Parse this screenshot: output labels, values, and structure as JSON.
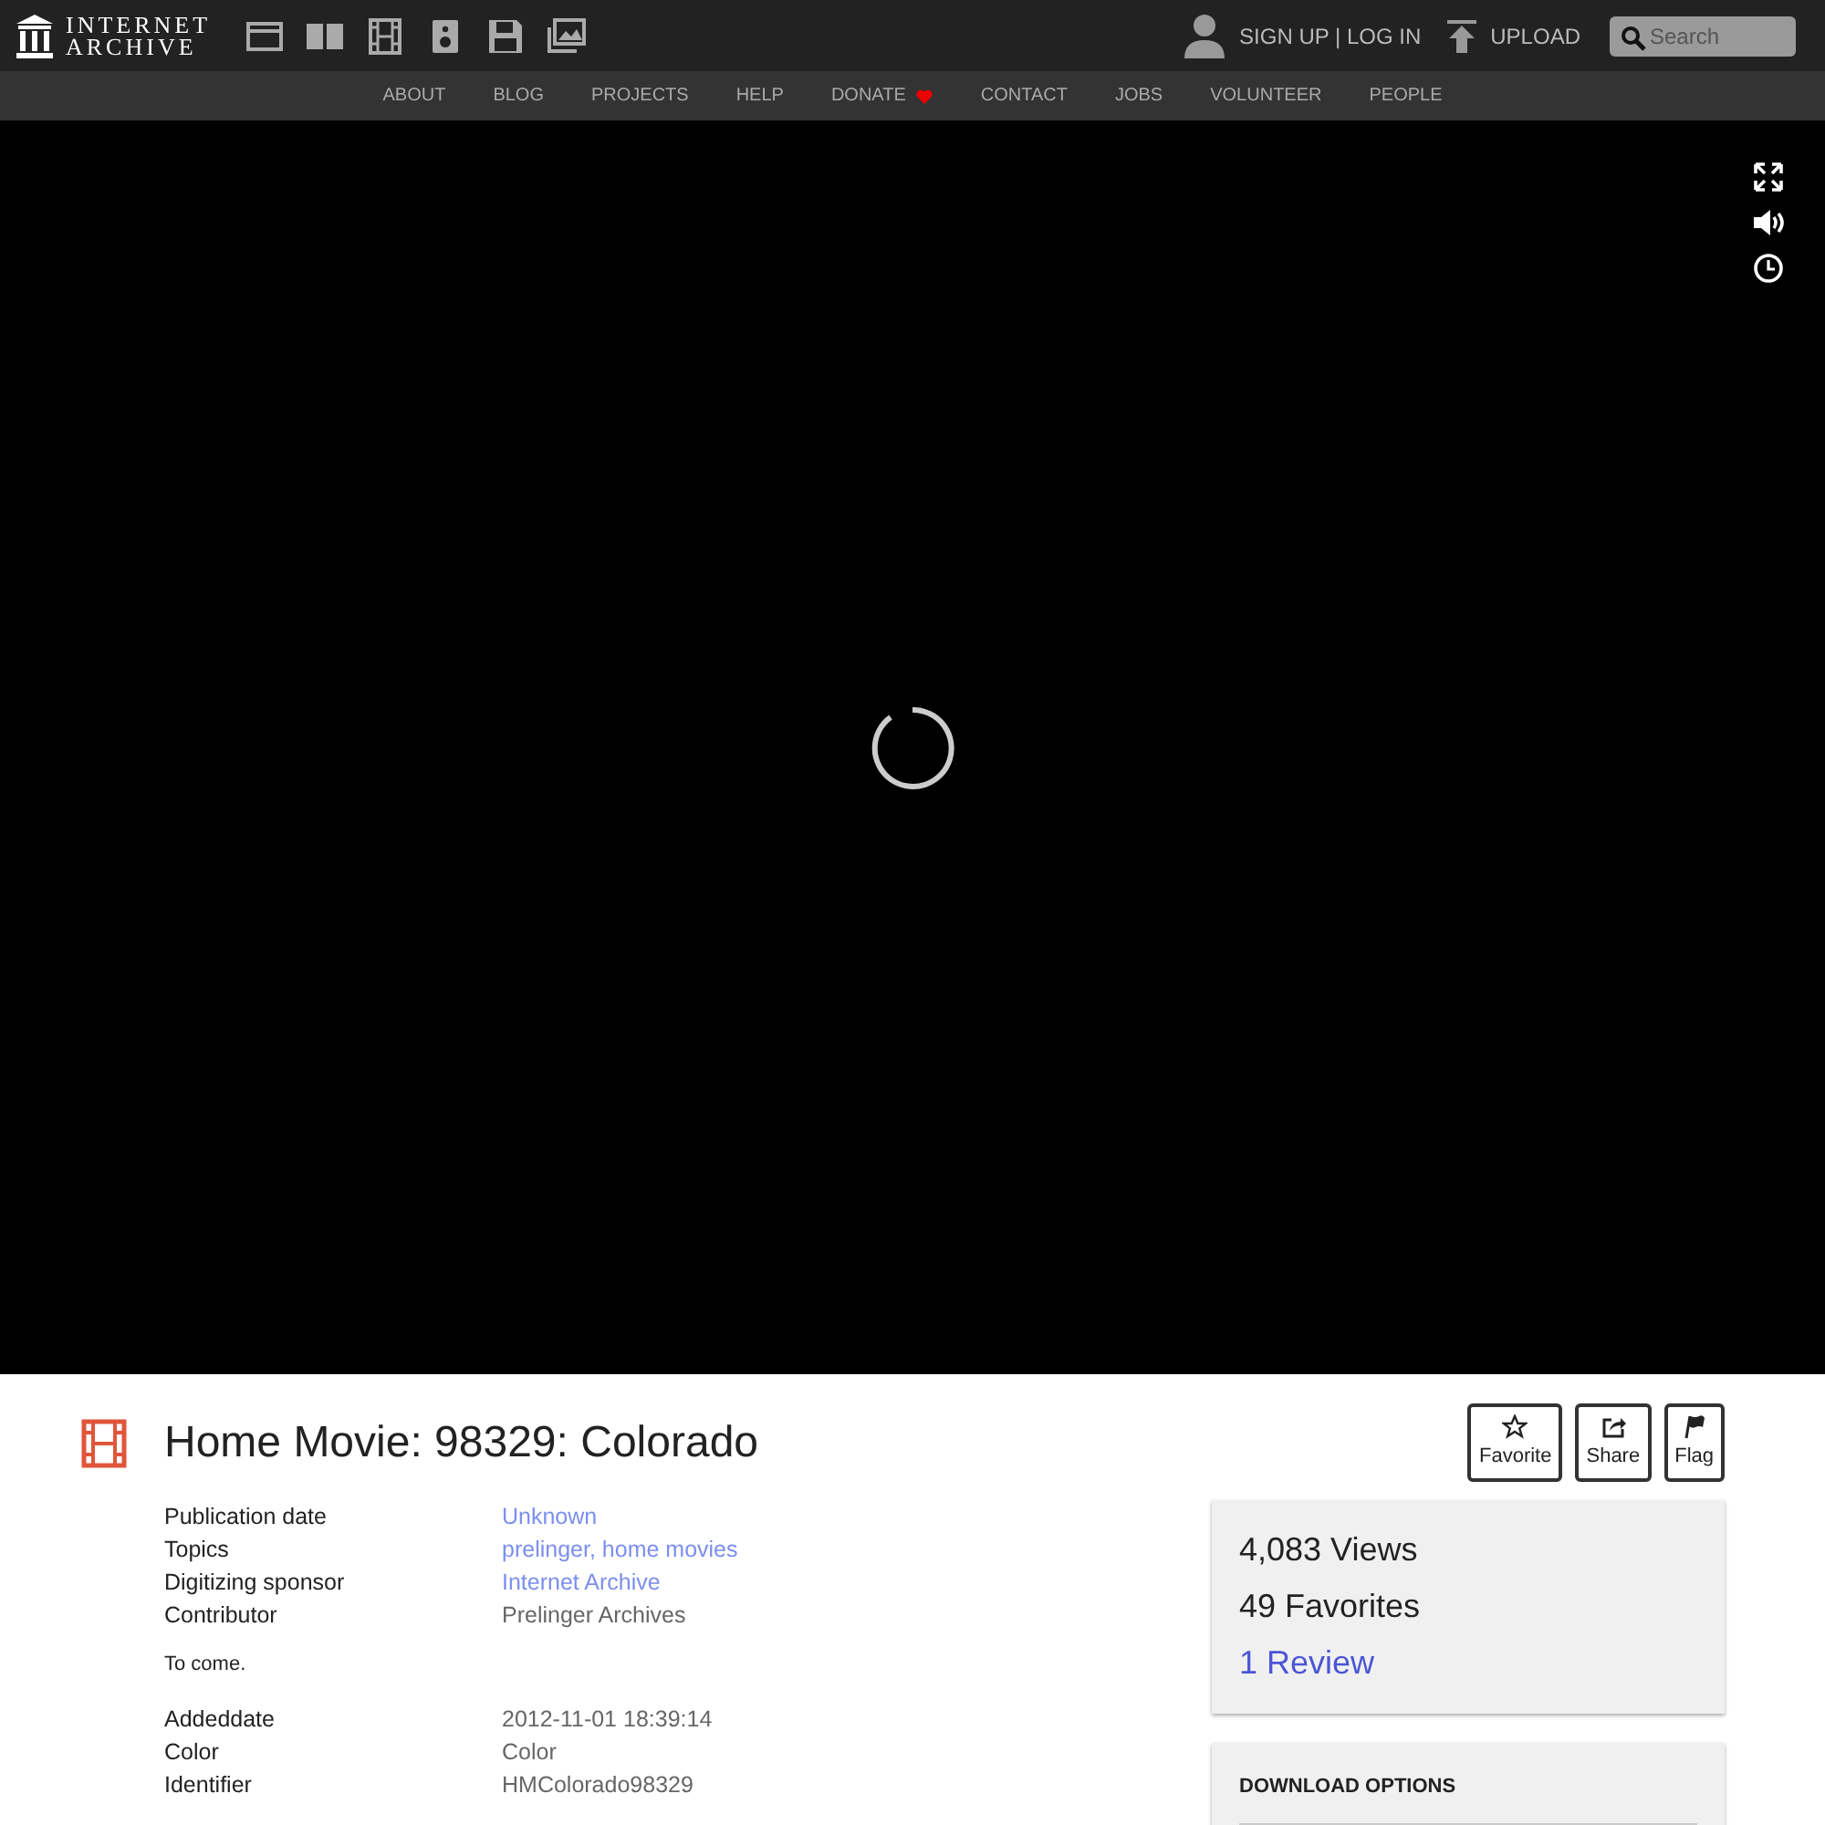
{
  "header": {
    "logo_lines": [
      "INTERNET",
      "ARCHIVE"
    ],
    "media_icons": [
      {
        "kind": "web"
      },
      {
        "kind": "texts"
      },
      {
        "kind": "video"
      },
      {
        "kind": "audio"
      },
      {
        "kind": "software"
      },
      {
        "kind": "images"
      }
    ],
    "account": "SIGN UP | LOG IN",
    "upload": "UPLOAD",
    "search": {
      "placeholder": "Search"
    }
  },
  "nav": [
    {
      "label": "ABOUT",
      "heart": false
    },
    {
      "label": "BLOG",
      "heart": false
    },
    {
      "label": "PROJECTS",
      "heart": false
    },
    {
      "label": "HELP",
      "heart": false
    },
    {
      "label": "DONATE",
      "heart": true
    },
    {
      "label": "CONTACT",
      "heart": false
    },
    {
      "label": "JOBS",
      "heart": false
    },
    {
      "label": "VOLUNTEER",
      "heart": false
    },
    {
      "label": "PEOPLE",
      "heart": false
    }
  ],
  "player": {
    "loading": true,
    "controls": [
      {
        "kind": "fullscreen"
      },
      {
        "kind": "volume"
      },
      {
        "kind": "clock"
      }
    ]
  },
  "item": {
    "title": "Home Movie: 98329: Colorado",
    "actions": [
      {
        "kind": "star",
        "label": "Favorite"
      },
      {
        "kind": "share",
        "label": "Share"
      },
      {
        "kind": "flag",
        "label": "Flag"
      }
    ],
    "metadata": [
      {
        "label": "Publication date",
        "values": [
          {
            "text": "Unknown",
            "link": true
          }
        ]
      },
      {
        "label": "Topics",
        "values": [
          {
            "text": "prelinger,",
            "link": true
          },
          {
            "text": "home movies",
            "link": true
          }
        ]
      },
      {
        "label": "Digitizing sponsor",
        "values": [
          {
            "text": "Internet Archive",
            "link": true
          }
        ]
      },
      {
        "label": "Contributor",
        "values": [
          {
            "text": "Prelinger Archives",
            "link": false
          }
        ]
      }
    ],
    "description": "To come.",
    "extra_metadata": [
      {
        "label": "Addeddate",
        "values": [
          {
            "text": "2012-11-01 18:39:14",
            "link": false
          }
        ]
      },
      {
        "label": "Color",
        "values": [
          {
            "text": "Color",
            "link": false
          }
        ]
      },
      {
        "label": "Identifier",
        "values": [
          {
            "text": "HMColorado98329",
            "link": false
          }
        ]
      }
    ],
    "stats": [
      {
        "kind": "count",
        "number": "4,083",
        "word": "Views"
      },
      {
        "kind": "count",
        "number": "49",
        "word": "Favorites"
      },
      {
        "kind": "link",
        "number": "1",
        "word": "Review"
      }
    ],
    "download_title": "DOWNLOAD OPTIONS"
  }
}
